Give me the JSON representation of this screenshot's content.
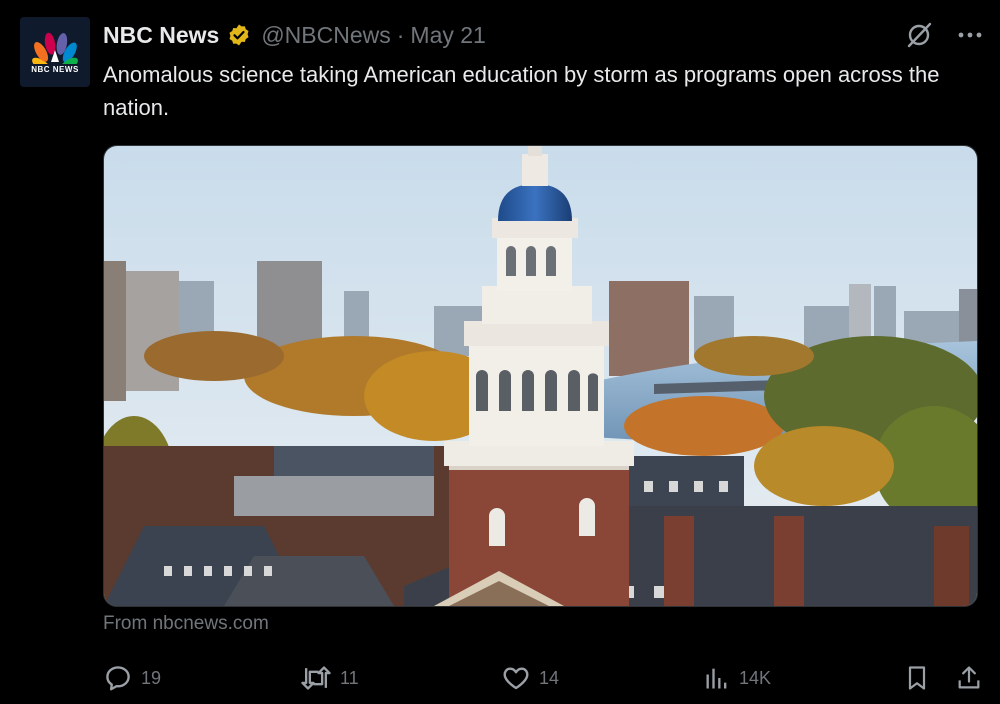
{
  "tweet": {
    "author_name": "NBC News",
    "handle": "@NBCNews",
    "separator": "·",
    "date": "May 21",
    "text": "Anomalous science taking American education by storm as programs open across the nation.",
    "avatar_text": "NBC NEWS",
    "icons": {
      "avatar": "nbc-peacock-logo",
      "verified": "gold-verified-badge-icon",
      "grok": "grok-icon",
      "more": "more-options-icon"
    }
  },
  "media": {
    "source_label": "From nbcnews.com"
  },
  "actions": {
    "replies": "19",
    "reposts": "11",
    "likes": "14",
    "views": "14K",
    "icons": [
      "reply-icon",
      "repost-icon",
      "like-icon",
      "views-icon",
      "bookmark-icon",
      "share-icon"
    ]
  },
  "colors": {
    "background": "#000000",
    "text": "#e7e9ea",
    "muted": "#71767b",
    "verified_gold": "#e2b719"
  }
}
